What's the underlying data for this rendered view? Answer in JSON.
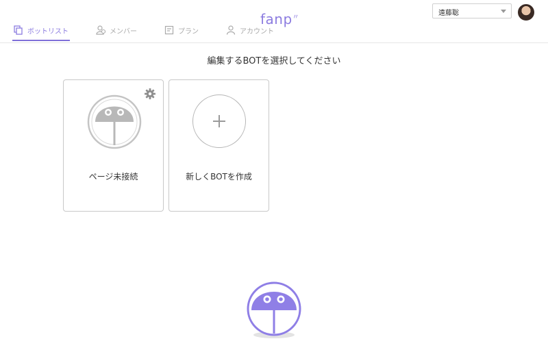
{
  "nav": {
    "items": [
      {
        "label": "ボットリスト",
        "icon": "copy-icon",
        "active": true
      },
      {
        "label": "メンバー",
        "icon": "members-icon",
        "active": false
      },
      {
        "label": "プラン",
        "icon": "plan-icon",
        "active": false
      },
      {
        "label": "アカウント",
        "icon": "account-icon",
        "active": false
      }
    ]
  },
  "logo": {
    "text": "fanp",
    "spark": "〃"
  },
  "user": {
    "selected": "遠藤聡"
  },
  "main": {
    "heading": "編集するBOTを選択してください",
    "cards": [
      {
        "label": "ページ未接続"
      },
      {
        "label": "新しくBOTを作成"
      }
    ]
  },
  "colors": {
    "accent": "#8c7ce0",
    "mascot": "#8f7fe6"
  }
}
